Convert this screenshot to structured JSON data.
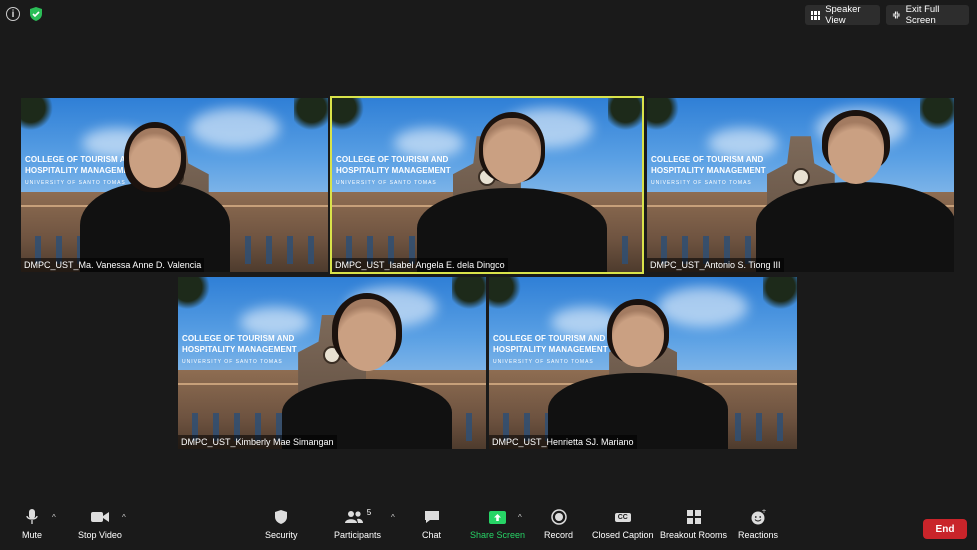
{
  "topbar": {
    "speaker_view_label": "Speaker View",
    "exit_fullscreen_label": "Exit Full Screen"
  },
  "background": {
    "college_line1": "COLLEGE OF TOURISM AND",
    "college_line2": "HOSPITALITY MANAGEMENT",
    "university": "UNIVERSITY OF SANTO TOMAS"
  },
  "participants": [
    {
      "name": "DMPC_UST_Ma. Vanessa Anne D. Valencia",
      "active": false
    },
    {
      "name": "DMPC_UST_Isabel Angela E. dela Dingco",
      "active": true
    },
    {
      "name": "DMPC_UST_Antonio S. Tiong III",
      "active": false
    },
    {
      "name": "DMPC_UST_Kimberly Mae Simangan",
      "active": false
    },
    {
      "name": "DMPC_UST_Henrietta SJ. Mariano",
      "active": false
    }
  ],
  "toolbar": {
    "mute": "Mute",
    "stop_video": "Stop Video",
    "security": "Security",
    "participants": "Participants",
    "participant_count": "5",
    "chat": "Chat",
    "share_screen": "Share Screen",
    "record": "Record",
    "closed_caption": "Closed Caption",
    "cc_badge": "CC",
    "breakout_rooms": "Breakout Rooms",
    "reactions": "Reactions",
    "end": "End"
  },
  "colors": {
    "active_speaker": "#d9e34a",
    "share_green": "#27d466",
    "end_red": "#c9242a"
  }
}
